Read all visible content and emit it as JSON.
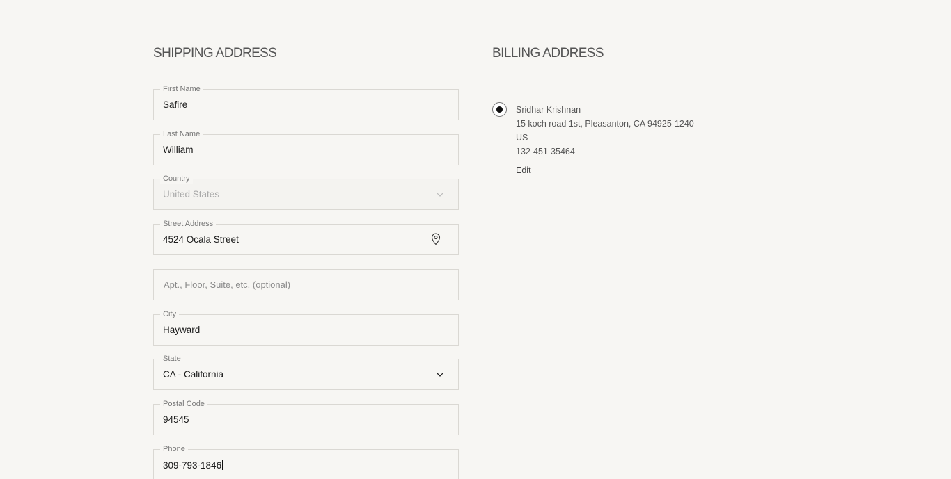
{
  "shipping": {
    "title": "SHIPPING ADDRESS",
    "first_name": {
      "label": "First Name",
      "value": "Safire"
    },
    "last_name": {
      "label": "Last Name",
      "value": "William"
    },
    "country": {
      "label": "Country",
      "value": "United States",
      "disabled": true
    },
    "street": {
      "label": "Street Address",
      "value": "4524 Ocala Street"
    },
    "apt": {
      "placeholder": "Apt., Floor, Suite, etc. (optional)"
    },
    "city": {
      "label": "City",
      "value": "Hayward"
    },
    "state": {
      "label": "State",
      "value": "CA - California"
    },
    "postal": {
      "label": "Postal Code",
      "value": "94545"
    },
    "phone": {
      "label": "Phone",
      "value": "309-793-1846"
    }
  },
  "billing": {
    "title": "BILLING ADDRESS",
    "selected": true,
    "name": "Sridhar Krishnan",
    "address_line": "15 koch road 1st, Pleasanton, CA 94925-1240",
    "country": "US",
    "phone": "132-451-35464",
    "edit_label": "Edit"
  },
  "icons": {
    "street_icon": "map-pin-icon",
    "dropdown_icon": "chevron-down-icon"
  },
  "colors": {
    "background": "#f7f6f3",
    "border": "#dad8d3",
    "text": "#1a1a1a",
    "muted_text": "#777777"
  }
}
